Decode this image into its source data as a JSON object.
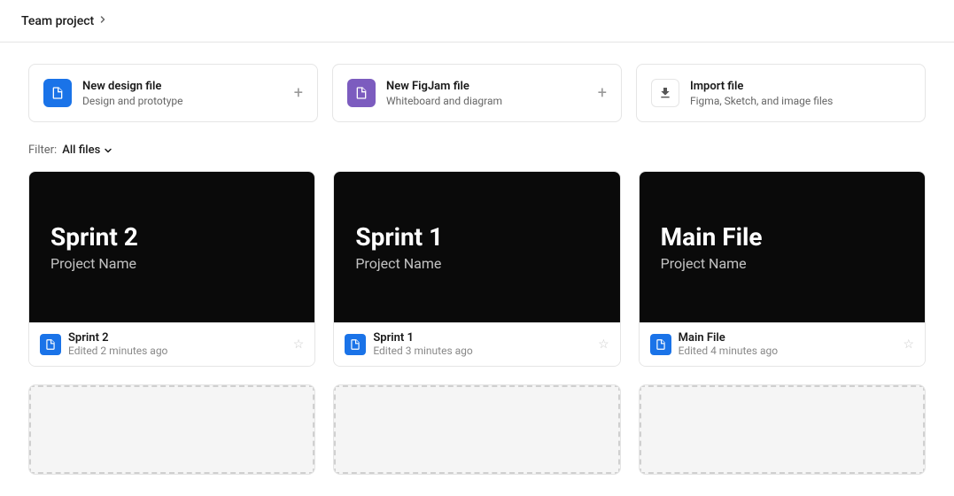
{
  "header": {
    "title": "Team project",
    "chevron": "›"
  },
  "action_cards": [
    {
      "id": "new-design",
      "icon_type": "blue",
      "title": "New design file",
      "subtitle": "Design and prototype",
      "plus": "+"
    },
    {
      "id": "new-figjam",
      "icon_type": "purple",
      "title": "New FigJam file",
      "subtitle": "Whiteboard and diagram",
      "plus": "+"
    },
    {
      "id": "import",
      "icon_type": "white",
      "title": "Import file",
      "subtitle": "Figma, Sketch, and image files"
    }
  ],
  "filter": {
    "label": "Filter:",
    "value": "All files",
    "chevron": "›"
  },
  "files": [
    {
      "id": "sprint2",
      "thumbnail_title": "Sprint 2",
      "thumbnail_subtitle": "Project Name",
      "name": "Sprint 2",
      "edited": "Edited 2 minutes ago"
    },
    {
      "id": "sprint1",
      "thumbnail_title": "Sprint 1",
      "thumbnail_subtitle": "Project Name",
      "name": "Sprint 1",
      "edited": "Edited 3 minutes ago"
    },
    {
      "id": "mainfile",
      "thumbnail_title": "Main File",
      "thumbnail_subtitle": "Project Name",
      "name": "Main File",
      "edited": "Edited 4 minutes ago"
    }
  ],
  "placeholders": [
    {
      "id": "ph1"
    },
    {
      "id": "ph2"
    },
    {
      "id": "ph3"
    }
  ]
}
